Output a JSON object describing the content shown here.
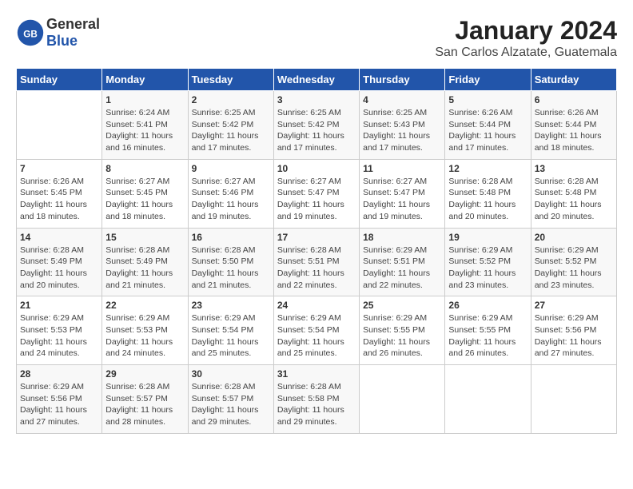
{
  "header": {
    "logo_general": "General",
    "logo_blue": "Blue",
    "title": "January 2024",
    "subtitle": "San Carlos Alzatate, Guatemala"
  },
  "calendar": {
    "days_of_week": [
      "Sunday",
      "Monday",
      "Tuesday",
      "Wednesday",
      "Thursday",
      "Friday",
      "Saturday"
    ],
    "weeks": [
      [
        {
          "num": "",
          "info": ""
        },
        {
          "num": "1",
          "info": "Sunrise: 6:24 AM\nSunset: 5:41 PM\nDaylight: 11 hours\nand 16 minutes."
        },
        {
          "num": "2",
          "info": "Sunrise: 6:25 AM\nSunset: 5:42 PM\nDaylight: 11 hours\nand 17 minutes."
        },
        {
          "num": "3",
          "info": "Sunrise: 6:25 AM\nSunset: 5:42 PM\nDaylight: 11 hours\nand 17 minutes."
        },
        {
          "num": "4",
          "info": "Sunrise: 6:25 AM\nSunset: 5:43 PM\nDaylight: 11 hours\nand 17 minutes."
        },
        {
          "num": "5",
          "info": "Sunrise: 6:26 AM\nSunset: 5:44 PM\nDaylight: 11 hours\nand 17 minutes."
        },
        {
          "num": "6",
          "info": "Sunrise: 6:26 AM\nSunset: 5:44 PM\nDaylight: 11 hours\nand 18 minutes."
        }
      ],
      [
        {
          "num": "7",
          "info": "Sunrise: 6:26 AM\nSunset: 5:45 PM\nDaylight: 11 hours\nand 18 minutes."
        },
        {
          "num": "8",
          "info": "Sunrise: 6:27 AM\nSunset: 5:45 PM\nDaylight: 11 hours\nand 18 minutes."
        },
        {
          "num": "9",
          "info": "Sunrise: 6:27 AM\nSunset: 5:46 PM\nDaylight: 11 hours\nand 19 minutes."
        },
        {
          "num": "10",
          "info": "Sunrise: 6:27 AM\nSunset: 5:47 PM\nDaylight: 11 hours\nand 19 minutes."
        },
        {
          "num": "11",
          "info": "Sunrise: 6:27 AM\nSunset: 5:47 PM\nDaylight: 11 hours\nand 19 minutes."
        },
        {
          "num": "12",
          "info": "Sunrise: 6:28 AM\nSunset: 5:48 PM\nDaylight: 11 hours\nand 20 minutes."
        },
        {
          "num": "13",
          "info": "Sunrise: 6:28 AM\nSunset: 5:48 PM\nDaylight: 11 hours\nand 20 minutes."
        }
      ],
      [
        {
          "num": "14",
          "info": "Sunrise: 6:28 AM\nSunset: 5:49 PM\nDaylight: 11 hours\nand 20 minutes."
        },
        {
          "num": "15",
          "info": "Sunrise: 6:28 AM\nSunset: 5:49 PM\nDaylight: 11 hours\nand 21 minutes."
        },
        {
          "num": "16",
          "info": "Sunrise: 6:28 AM\nSunset: 5:50 PM\nDaylight: 11 hours\nand 21 minutes."
        },
        {
          "num": "17",
          "info": "Sunrise: 6:28 AM\nSunset: 5:51 PM\nDaylight: 11 hours\nand 22 minutes."
        },
        {
          "num": "18",
          "info": "Sunrise: 6:29 AM\nSunset: 5:51 PM\nDaylight: 11 hours\nand 22 minutes."
        },
        {
          "num": "19",
          "info": "Sunrise: 6:29 AM\nSunset: 5:52 PM\nDaylight: 11 hours\nand 23 minutes."
        },
        {
          "num": "20",
          "info": "Sunrise: 6:29 AM\nSunset: 5:52 PM\nDaylight: 11 hours\nand 23 minutes."
        }
      ],
      [
        {
          "num": "21",
          "info": "Sunrise: 6:29 AM\nSunset: 5:53 PM\nDaylight: 11 hours\nand 24 minutes."
        },
        {
          "num": "22",
          "info": "Sunrise: 6:29 AM\nSunset: 5:53 PM\nDaylight: 11 hours\nand 24 minutes."
        },
        {
          "num": "23",
          "info": "Sunrise: 6:29 AM\nSunset: 5:54 PM\nDaylight: 11 hours\nand 25 minutes."
        },
        {
          "num": "24",
          "info": "Sunrise: 6:29 AM\nSunset: 5:54 PM\nDaylight: 11 hours\nand 25 minutes."
        },
        {
          "num": "25",
          "info": "Sunrise: 6:29 AM\nSunset: 5:55 PM\nDaylight: 11 hours\nand 26 minutes."
        },
        {
          "num": "26",
          "info": "Sunrise: 6:29 AM\nSunset: 5:55 PM\nDaylight: 11 hours\nand 26 minutes."
        },
        {
          "num": "27",
          "info": "Sunrise: 6:29 AM\nSunset: 5:56 PM\nDaylight: 11 hours\nand 27 minutes."
        }
      ],
      [
        {
          "num": "28",
          "info": "Sunrise: 6:29 AM\nSunset: 5:56 PM\nDaylight: 11 hours\nand 27 minutes."
        },
        {
          "num": "29",
          "info": "Sunrise: 6:28 AM\nSunset: 5:57 PM\nDaylight: 11 hours\nand 28 minutes."
        },
        {
          "num": "30",
          "info": "Sunrise: 6:28 AM\nSunset: 5:57 PM\nDaylight: 11 hours\nand 29 minutes."
        },
        {
          "num": "31",
          "info": "Sunrise: 6:28 AM\nSunset: 5:58 PM\nDaylight: 11 hours\nand 29 minutes."
        },
        {
          "num": "",
          "info": ""
        },
        {
          "num": "",
          "info": ""
        },
        {
          "num": "",
          "info": ""
        }
      ]
    ]
  }
}
